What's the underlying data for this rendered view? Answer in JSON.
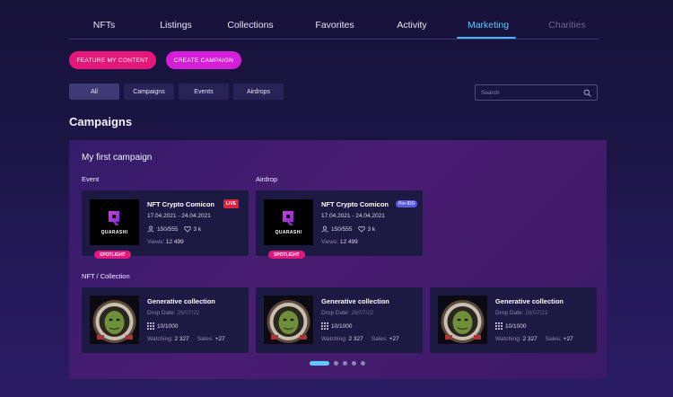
{
  "nav": {
    "tabs": [
      {
        "label": "NFTs",
        "state": "normal"
      },
      {
        "label": "Listings",
        "state": "normal"
      },
      {
        "label": "Collections",
        "state": "normal"
      },
      {
        "label": "Favorites",
        "state": "normal"
      },
      {
        "label": "Activity",
        "state": "normal"
      },
      {
        "label": "Marketing",
        "state": "active"
      },
      {
        "label": "Charities",
        "state": "disabled"
      }
    ]
  },
  "actions": {
    "feature_label": "Feature my content",
    "create_label": "Create campaign"
  },
  "filters": {
    "items": [
      "All",
      "Campaigns",
      "Events",
      "Airdrops"
    ],
    "selected": "All"
  },
  "search": {
    "placeholder": "Search",
    "value": ""
  },
  "section_title": "Campaigns",
  "campaign": {
    "title": "My first campaign",
    "event": {
      "label": "Event",
      "card": {
        "logo_text": "QUARASHI",
        "title": "NFT Crypto Comicon",
        "badge": "LIVE",
        "dates": "17.04.2021 - 24.04.2021",
        "participants": "150/555",
        "likes": "3 k",
        "views_label": "Views:",
        "views_value": "12 499",
        "tag": "Spotlight"
      }
    },
    "airdrop": {
      "label": "Airdrop",
      "card": {
        "logo_text": "QUARASHI",
        "title": "NFT Crypto Comicon",
        "badge": "Pre-IDO",
        "dates": "17.04.2021 - 24.04.2021",
        "participants": "150/555",
        "likes": "3 k",
        "views_label": "Views:",
        "views_value": "12 499",
        "tag": "Spotlight"
      }
    },
    "nft_collection": {
      "label": "NFT / Collection",
      "cards": [
        {
          "title": "Generative collection",
          "drop_label": "Drop Date:",
          "drop_date": "26/07/22",
          "supply": "10/1000",
          "watching_label": "Watching:",
          "watching_value": "2 327",
          "sales_label": "Sales:",
          "sales_value": "+27"
        },
        {
          "title": "Generative collection",
          "drop_label": "Drop Date:",
          "drop_date": "26/07/22",
          "supply": "10/1000",
          "watching_label": "Watching:",
          "watching_value": "2 327",
          "sales_label": "Sales:",
          "sales_value": "+27"
        },
        {
          "title": "Generative collection",
          "drop_label": "Drop Date:",
          "drop_date": "26/07/22",
          "supply": "10/1000",
          "watching_label": "Watching:",
          "watching_value": "2 327",
          "sales_label": "Sales:",
          "sales_value": "+27"
        }
      ]
    },
    "pager": {
      "count": 5,
      "active": 1
    }
  },
  "colors": {
    "accent_blue": "#5cc8ff",
    "pink": "#e5177a",
    "magenta": "#d41fd6",
    "live_red": "#e0223f",
    "preido_blue": "#5a5be0"
  }
}
